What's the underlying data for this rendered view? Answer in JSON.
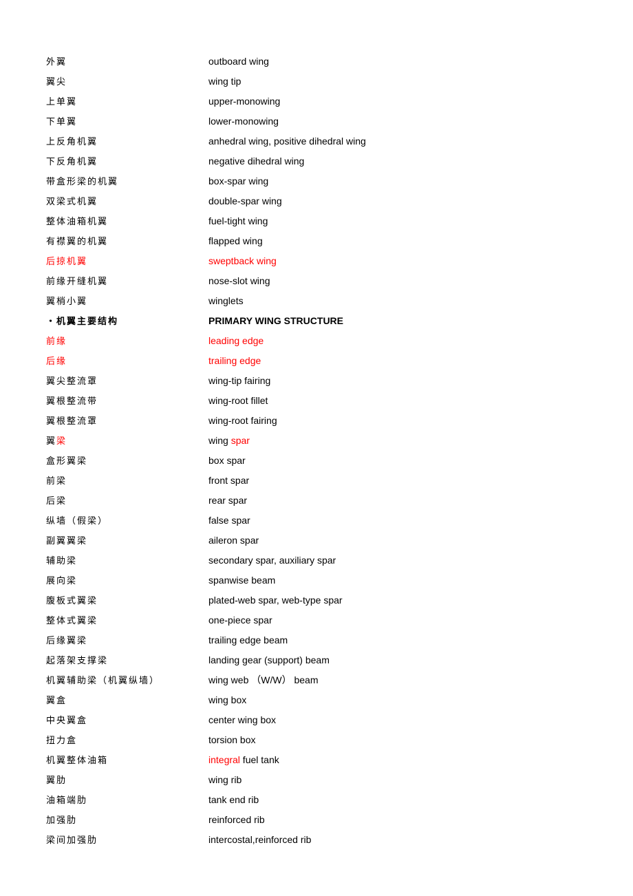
{
  "colors": {
    "highlight": "#ff0000",
    "text": "#000000"
  },
  "entries": [
    {
      "zh": [
        {
          "t": "外翼"
        }
      ],
      "en": [
        {
          "t": "outboard wing"
        }
      ]
    },
    {
      "zh": [
        {
          "t": "翼尖"
        }
      ],
      "en": [
        {
          "t": "wing tip"
        }
      ]
    },
    {
      "zh": [
        {
          "t": "上单翼"
        }
      ],
      "en": [
        {
          "t": "upper-monowing"
        }
      ]
    },
    {
      "zh": [
        {
          "t": "下单翼"
        }
      ],
      "en": [
        {
          "t": "lower-monowing"
        }
      ]
    },
    {
      "zh": [
        {
          "t": "上反角机翼"
        }
      ],
      "en": [
        {
          "t": "anhedral wing, positive dihedral wing"
        }
      ]
    },
    {
      "zh": [
        {
          "t": "下反角机翼"
        }
      ],
      "en": [
        {
          "t": "negative dihedral wing"
        }
      ]
    },
    {
      "zh": [
        {
          "t": "带盒形梁的机翼"
        }
      ],
      "en": [
        {
          "t": "box-spar wing"
        }
      ]
    },
    {
      "zh": [
        {
          "t": "双梁式机翼"
        }
      ],
      "en": [
        {
          "t": "double-spar wing"
        }
      ]
    },
    {
      "zh": [
        {
          "t": "整体油箱机翼"
        }
      ],
      "en": [
        {
          "t": "fuel-tight wing"
        }
      ]
    },
    {
      "zh": [
        {
          "t": "有襟翼的机翼"
        }
      ],
      "en": [
        {
          "t": "flapped wing"
        }
      ]
    },
    {
      "zh": [
        {
          "t": "后掠机翼",
          "red": true
        }
      ],
      "en": [
        {
          "t": "sweptback wing",
          "red": true
        }
      ]
    },
    {
      "zh": [
        {
          "t": "前缘开缝机翼"
        }
      ],
      "en": [
        {
          "t": "nose-slot wing"
        }
      ]
    },
    {
      "zh": [
        {
          "t": "翼梢小翼"
        }
      ],
      "en": [
        {
          "t": "winglets"
        }
      ]
    },
    {
      "bold": true,
      "zh": [
        {
          "t": "・机翼主要结构"
        }
      ],
      "en": [
        {
          "t": "PRIMARY WING STRUCTURE"
        }
      ]
    },
    {
      "zh": [
        {
          "t": "前缘",
          "red": true
        }
      ],
      "en": [
        {
          "t": "leading edge",
          "red": true
        }
      ]
    },
    {
      "zh": [
        {
          "t": "后缘",
          "red": true
        }
      ],
      "en": [
        {
          "t": "trailing edge",
          "red": true
        }
      ]
    },
    {
      "zh": [
        {
          "t": "翼尖整流罩"
        }
      ],
      "en": [
        {
          "t": "wing-tip fairing"
        }
      ]
    },
    {
      "zh": [
        {
          "t": "翼根整流带"
        }
      ],
      "en": [
        {
          "t": "wing-root fillet"
        }
      ]
    },
    {
      "zh": [
        {
          "t": "翼根整流罩"
        }
      ],
      "en": [
        {
          "t": "wing-root fairing"
        }
      ]
    },
    {
      "zh": [
        {
          "t": "翼"
        },
        {
          "t": "梁",
          "red": true
        }
      ],
      "en": [
        {
          "t": "wing "
        },
        {
          "t": "spar",
          "red": true
        }
      ]
    },
    {
      "zh": [
        {
          "t": "盒形翼梁"
        }
      ],
      "en": [
        {
          "t": "box spar"
        }
      ]
    },
    {
      "zh": [
        {
          "t": "前梁"
        }
      ],
      "en": [
        {
          "t": "front spar"
        }
      ]
    },
    {
      "zh": [
        {
          "t": "后梁"
        }
      ],
      "en": [
        {
          "t": "rear spar"
        }
      ]
    },
    {
      "zh": [
        {
          "t": "纵墙（假梁）"
        }
      ],
      "en": [
        {
          "t": "false spar"
        }
      ]
    },
    {
      "zh": [
        {
          "t": "副翼翼梁"
        }
      ],
      "en": [
        {
          "t": "aileron spar"
        }
      ]
    },
    {
      "zh": [
        {
          "t": "辅助梁"
        }
      ],
      "en": [
        {
          "t": "secondary spar, auxiliary spar"
        }
      ]
    },
    {
      "zh": [
        {
          "t": "展向梁"
        }
      ],
      "en": [
        {
          "t": "spanwise beam"
        }
      ]
    },
    {
      "zh": [
        {
          "t": "腹板式翼梁"
        }
      ],
      "en": [
        {
          "t": "plated-web spar, web-type spar"
        }
      ]
    },
    {
      "zh": [
        {
          "t": "整体式翼梁"
        }
      ],
      "en": [
        {
          "t": "one-piece spar"
        }
      ]
    },
    {
      "zh": [
        {
          "t": "后缘翼梁"
        }
      ],
      "en": [
        {
          "t": "trailing edge beam"
        }
      ]
    },
    {
      "zh": [
        {
          "t": "起落架支撑梁"
        }
      ],
      "en": [
        {
          "t": "landing gear (support) beam"
        }
      ]
    },
    {
      "zh": [
        {
          "t": "机翼辅助梁（机翼纵墙）"
        }
      ],
      "en": [
        {
          "t": "wing web （W/W） beam"
        }
      ]
    },
    {
      "zh": [
        {
          "t": "翼盒"
        }
      ],
      "en": [
        {
          "t": "wing box"
        }
      ]
    },
    {
      "zh": [
        {
          "t": "中央翼盒"
        }
      ],
      "en": [
        {
          "t": "center wing box"
        }
      ]
    },
    {
      "zh": [
        {
          "t": "扭力盒"
        }
      ],
      "en": [
        {
          "t": "torsion box"
        }
      ]
    },
    {
      "zh": [
        {
          "t": "机翼整体油箱"
        }
      ],
      "en": [
        {
          "t": "integral",
          "red": true
        },
        {
          "t": " fuel tank"
        }
      ]
    },
    {
      "zh": [
        {
          "t": "翼肋"
        }
      ],
      "en": [
        {
          "t": "wing rib"
        }
      ]
    },
    {
      "zh": [
        {
          "t": "油箱端肋"
        }
      ],
      "en": [
        {
          "t": "tank end rib"
        }
      ]
    },
    {
      "zh": [
        {
          "t": "加强肋"
        }
      ],
      "en": [
        {
          "t": "reinforced rib"
        }
      ]
    },
    {
      "zh": [
        {
          "t": "梁间加强肋"
        }
      ],
      "en": [
        {
          "t": "intercostal,reinforced rib"
        }
      ]
    }
  ]
}
